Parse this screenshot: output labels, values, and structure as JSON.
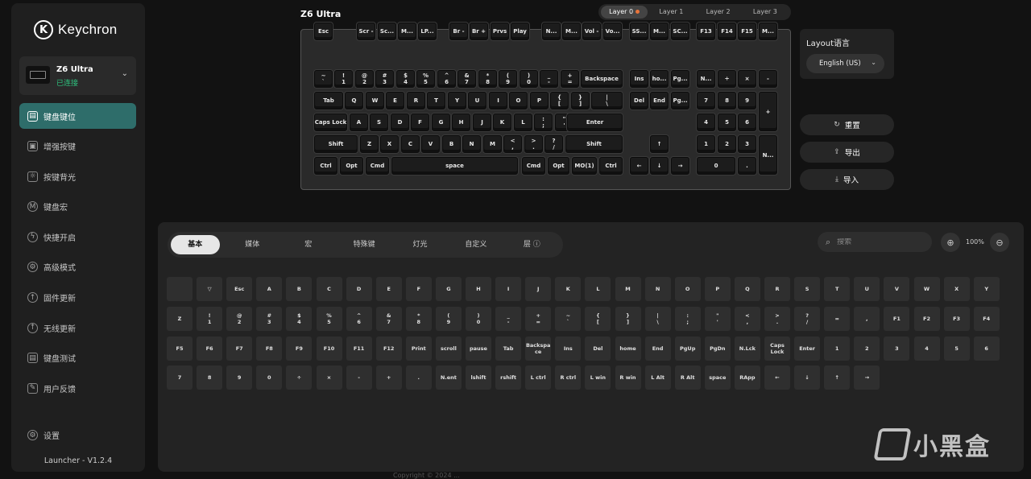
{
  "app": {
    "brand": "Keychron",
    "version": "Launcher - V1.2.4"
  },
  "device": {
    "name": "Z6 Ultra",
    "status": "已连接"
  },
  "nav": [
    {
      "label": "键盘键位",
      "icon": "keyboard-icon",
      "active": true
    },
    {
      "label": "增强按键",
      "icon": "key-plus-icon"
    },
    {
      "label": "按键背光",
      "icon": "light-icon"
    },
    {
      "label": "键盘宏",
      "icon": "macro-icon"
    },
    {
      "label": "快捷开启",
      "icon": "flash-icon"
    },
    {
      "label": "高级模式",
      "icon": "gear-icon"
    },
    {
      "label": "固件更新",
      "icon": "upload-icon"
    },
    {
      "label": "无线更新",
      "icon": "upload-icon"
    },
    {
      "label": "键盘测试",
      "icon": "keyboard-test-icon"
    },
    {
      "label": "用户反馈",
      "icon": "feedback-icon"
    }
  ],
  "settings_label": "设置",
  "keyboard_title": "Z6 Ultra",
  "layers": [
    "Layer 0",
    "Layer 1",
    "Layer 2",
    "Layer 3"
  ],
  "layout": {
    "title": "Layout语言",
    "value": "English (US)"
  },
  "actions": {
    "reset": "重置",
    "export": "导出",
    "import": "导入"
  },
  "keyboard_keys": [
    [
      "Esc"
    ],
    [
      "Scr -"
    ],
    [
      "Sc..."
    ],
    [
      "M..."
    ],
    [
      "LP..."
    ],
    [
      "Br -"
    ],
    [
      "Br +"
    ],
    [
      "Prvs"
    ],
    [
      "Play"
    ],
    [
      "N..."
    ],
    [
      "M..."
    ],
    [
      "Vol -"
    ],
    [
      "Vo..."
    ],
    [
      "SS..."
    ],
    [
      "M..."
    ],
    [
      "SC..."
    ],
    [
      "F13"
    ],
    [
      "F14"
    ],
    [
      "F15"
    ],
    [
      "M..."
    ],
    [
      "~\n`"
    ],
    [
      "!\n1"
    ],
    [
      "@\n2"
    ],
    [
      "#\n3"
    ],
    [
      "$\n4"
    ],
    [
      "%\n5"
    ],
    [
      "^\n6"
    ],
    [
      "&\n7"
    ],
    [
      "*\n8"
    ],
    [
      "(\n9"
    ],
    [
      ")\n0"
    ],
    [
      "_\n-"
    ],
    [
      "+\n="
    ],
    [
      "Backspace"
    ],
    [
      "Ins"
    ],
    [
      "ho..."
    ],
    [
      "Pg..."
    ],
    [
      "N..."
    ],
    [
      "÷"
    ],
    [
      "×"
    ],
    [
      "-"
    ],
    [
      "Tab"
    ],
    [
      "Q"
    ],
    [
      "W"
    ],
    [
      "E"
    ],
    [
      "R"
    ],
    [
      "T"
    ],
    [
      "Y"
    ],
    [
      "U"
    ],
    [
      "I"
    ],
    [
      "O"
    ],
    [
      "P"
    ],
    [
      "{\n["
    ],
    [
      "}\n]"
    ],
    [
      "|\n\\"
    ],
    [
      "Del"
    ],
    [
      "End"
    ],
    [
      "Pg..."
    ],
    [
      "7"
    ],
    [
      "8"
    ],
    [
      "9"
    ],
    [
      "+"
    ],
    [
      "Caps Lock"
    ],
    [
      "A"
    ],
    [
      "S"
    ],
    [
      "D"
    ],
    [
      "F"
    ],
    [
      "G"
    ],
    [
      "H"
    ],
    [
      "J"
    ],
    [
      "K"
    ],
    [
      "L"
    ],
    [
      ":\n;"
    ],
    [
      "\"\n'"
    ],
    [
      "Enter"
    ],
    [
      "4"
    ],
    [
      "5"
    ],
    [
      "6"
    ],
    [
      "Shift"
    ],
    [
      "Z"
    ],
    [
      "X"
    ],
    [
      "C"
    ],
    [
      "V"
    ],
    [
      "B"
    ],
    [
      "N"
    ],
    [
      "M"
    ],
    [
      "<\n,"
    ],
    [
      ">\n."
    ],
    [
      "?\n/"
    ],
    [
      "Shift"
    ],
    [
      "↑"
    ],
    [
      "1"
    ],
    [
      "2"
    ],
    [
      "3"
    ],
    [
      "N..."
    ],
    [
      "Ctrl"
    ],
    [
      "Opt"
    ],
    [
      "Cmd"
    ],
    [
      "space"
    ],
    [
      "Cmd"
    ],
    [
      "Opt"
    ],
    [
      "MO(1)"
    ],
    [
      "Ctrl"
    ],
    [
      "←"
    ],
    [
      "↓"
    ],
    [
      "→"
    ],
    [
      "0"
    ],
    [
      "."
    ]
  ],
  "categories": [
    "基本",
    "媒体",
    "宏",
    "特殊键",
    "灯光",
    "自定义",
    "层 ⓘ"
  ],
  "search_placeholder": "搜索",
  "zoom": "100%",
  "picker_rows": [
    [
      "",
      "▽",
      "Esc",
      "A",
      "B",
      "C",
      "D",
      "E",
      "F",
      "G",
      "H",
      "I",
      "J",
      "K",
      "L",
      "M",
      "N",
      "O",
      "P",
      "Q",
      "R",
      "S",
      "T",
      "U",
      "V",
      "W",
      "X",
      "Y"
    ],
    [
      "Z",
      "!\n1",
      "@\n2",
      "#\n3",
      "$\n4",
      "%\n5",
      "^\n6",
      "&\n7",
      "*\n8",
      "(\n9",
      ")\n0",
      "_\n-",
      "+\n=",
      "~\n`",
      "{\n[",
      "}\n]",
      "|\n\\",
      ":\n;",
      "\"\n'",
      "<\n,",
      ">\n.",
      "?\n/",
      "=",
      ",",
      "F1",
      "F2",
      "F3",
      "F4"
    ],
    [
      "F5",
      "F6",
      "F7",
      "F8",
      "F9",
      "F10",
      "F11",
      "F12",
      "Print",
      "scroll",
      "pause",
      "Tab",
      "Backspa\nce",
      "Ins",
      "Del",
      "home",
      "End",
      "PgUp",
      "PgDn",
      "N.Lck",
      "Caps\nLock",
      "Enter",
      "1",
      "2",
      "3",
      "4",
      "5",
      "6"
    ],
    [
      "7",
      "8",
      "9",
      "0",
      "÷",
      "×",
      "-",
      "+",
      ".",
      "N.ent",
      "lshift",
      "rshift",
      "L ctrl",
      "R ctrl",
      "L win",
      "R win",
      "L Alt",
      "R Alt",
      "space",
      "RApp",
      "←",
      "↓",
      "↑",
      "→"
    ]
  ],
  "footer": "Copyright © 2024 ...",
  "watermark": "小黑盒",
  "colors": {
    "accent": "#2e6d6a",
    "status": "#2ec27e",
    "layer_dot": "#e8743b"
  }
}
